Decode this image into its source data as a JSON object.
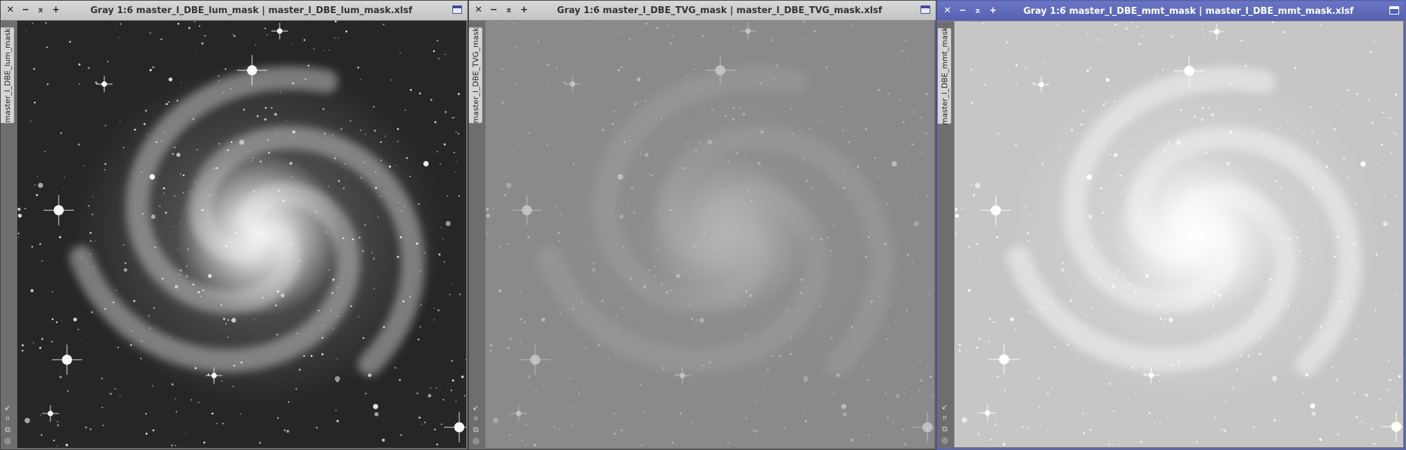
{
  "windows": [
    {
      "title": "Gray 1:6 master_l_DBE_lum_mask | master_l_DBE_lum_mask.xlsf",
      "side_tab": "master_l_DBE_lum_mask",
      "active": false
    },
    {
      "title": "Gray 1:6 master_l_DBE_TVG_mask | master_l_DBE_TVG_mask.xlsf",
      "side_tab": "master_l_DBE_TVG_mask",
      "active": false
    },
    {
      "title": "Gray 1:6 master_l_DBE_mmt_mask | master_l_DBE_mmt_mask.xlsf",
      "side_tab": "master_l_DBE_mmt_mask",
      "active": true
    }
  ],
  "titlebar_buttons": {
    "close": "✕",
    "minimize": "−",
    "shade": "⌅",
    "pin": "+"
  },
  "side_icons": [
    "↙",
    "⌗",
    "⧉",
    "◎"
  ],
  "colors": {
    "active_border": "#5865b4",
    "active_titlebar": "#5561b0",
    "inactive_titlebar": "#cdcdcd"
  }
}
